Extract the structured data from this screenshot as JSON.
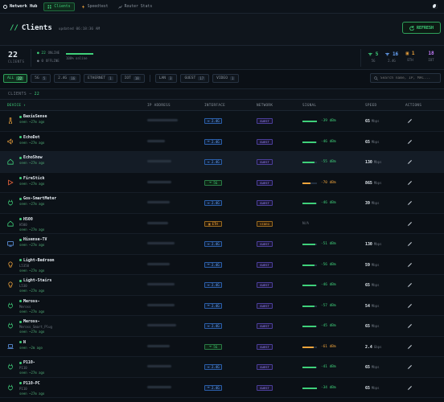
{
  "nav": {
    "brand": "Network Hub",
    "tabs": [
      {
        "label": "Clients",
        "icon": "grid-icon",
        "active": true
      },
      {
        "label": "Speedtest",
        "icon": "bolt-icon",
        "active": false
      },
      {
        "label": "Router Stats",
        "icon": "chart-icon",
        "active": false
      }
    ],
    "theme_icon": "moon-icon"
  },
  "header": {
    "prefix": "//",
    "title": "Clients",
    "updated": "updated 06:18:36 AM",
    "refresh_label": "REFRESH"
  },
  "stats": {
    "total": "22",
    "total_label": "CLIENTS",
    "online": "22",
    "online_label": "ONLINE",
    "offline": "0",
    "offline_label": "OFFLINE",
    "online_pct_text": "100% online",
    "online_fraction": 1.0,
    "bands": [
      {
        "value": "5",
        "label": "5G",
        "color": "#3fd07a"
      },
      {
        "value": "16",
        "label": "2.4G",
        "color": "#6aa8ff"
      },
      {
        "value": "1",
        "label": "ETH",
        "color": "#f0a43c"
      },
      {
        "value": "18",
        "label": "IOT",
        "color": "#c77dff"
      }
    ]
  },
  "filters": [
    {
      "label": "ALL",
      "count": "22",
      "active": true
    },
    {
      "label": "5G",
      "count": "5",
      "active": false
    },
    {
      "label": "2.4G",
      "count": "16",
      "active": false
    },
    {
      "label": "ETHERNET",
      "count": "1",
      "active": false
    },
    {
      "label": "IOT",
      "count": "18",
      "active": false
    },
    {
      "label": "LAN",
      "count": "3",
      "active": false
    },
    {
      "label": "GUEST",
      "count": "17",
      "active": false
    },
    {
      "label": "VIDEO",
      "count": "1",
      "active": false
    }
  ],
  "search": {
    "placeholder": "Search name, IP, MAC..."
  },
  "list": {
    "title": "CLIENTS",
    "sep": "—",
    "count": "22"
  },
  "columns": {
    "device": "DEVICE ↑",
    "ip": "IP ADDRESS",
    "iface": "INTERFACE",
    "network": "NETWORK",
    "signal": "SIGNAL",
    "speed": "SPEED",
    "actions": "ACTIONS"
  },
  "rows": [
    {
      "name": "BaxiuSense",
      "sub": "",
      "seen": "seen ~27m ago",
      "icon": "thermometer-icon",
      "icolor": "#f0a43c",
      "iface": "2.4G",
      "itype": "b2",
      "net": "GUEST",
      "signal": "-39 dBm",
      "sig_fill": 1.0,
      "sig_color": "#3fd07a",
      "speed": "65",
      "unit": "Mbps"
    },
    {
      "name": "EchoDot",
      "sub": "",
      "seen": "seen ~27m ago",
      "icon": "speaker-icon",
      "icolor": "#f0a43c",
      "iface": "2.4G",
      "itype": "b2",
      "net": "GUEST",
      "signal": "-46 dBm",
      "sig_fill": 0.95,
      "sig_color": "#3fd07a",
      "speed": "65",
      "unit": "Mbps"
    },
    {
      "name": "EchoShow",
      "sub": "",
      "seen": "seen ~27m ago",
      "icon": "home-icon",
      "icolor": "#3fd07a",
      "iface": "2.4G",
      "itype": "b2",
      "net": "GUEST",
      "signal": "-55 dBm",
      "sig_fill": 0.85,
      "sig_color": "#3fd07a",
      "speed": "130",
      "unit": "Mbps"
    },
    {
      "name": "FireStick",
      "sub": "",
      "seen": "seen ~27m ago",
      "icon": "play-icon",
      "icolor": "#f0663c",
      "iface": "5G",
      "itype": "b5",
      "net": "GUEST",
      "signal": "-70 dBm",
      "sig_fill": 0.55,
      "sig_color": "#f0a43c",
      "speed": "865",
      "unit": "Mbps"
    },
    {
      "name": "Gos-SmartMeter",
      "sub": "",
      "seen": "seen ~27m ago",
      "icon": "plug-icon",
      "icolor": "#3fd07a",
      "iface": "2.4G",
      "itype": "b2",
      "net": "GUEST",
      "signal": "-46 dBm",
      "sig_fill": 0.95,
      "sig_color": "#3fd07a",
      "speed": "39",
      "unit": "Mbps"
    },
    {
      "name": "H500",
      "sub": "H500",
      "seen": "seen ~27m ago",
      "icon": "home-icon",
      "icolor": "#3fd07a",
      "iface": "ETH",
      "itype": "eth",
      "net": "VIDEO",
      "signal": "N/A",
      "sig_fill": 0,
      "sig_color": "#6e7681",
      "speed": "",
      "unit": ""
    },
    {
      "name": "Hisense-TV",
      "sub": "",
      "seen": "seen ~27m ago",
      "icon": "tv-icon",
      "icolor": "#6aa8ff",
      "iface": "2.4G",
      "itype": "b2",
      "net": "GUEST",
      "signal": "-51 dBm",
      "sig_fill": 0.9,
      "sig_color": "#3fd07a",
      "speed": "130",
      "unit": "Mbps"
    },
    {
      "name": "Light-Bedroom",
      "sub": "L5350",
      "seen": "seen ~27m ago",
      "icon": "bulb-icon",
      "icolor": "#f0a43c",
      "iface": "2.4G",
      "itype": "b2",
      "net": "GUEST",
      "signal": "-56 dBm",
      "sig_fill": 0.85,
      "sig_color": "#3fd07a",
      "speed": "59",
      "unit": "Mbps"
    },
    {
      "name": "Light-Stairs",
      "sub": "L530",
      "seen": "seen ~27m ago",
      "icon": "bulb-icon",
      "icolor": "#f0a43c",
      "iface": "2.4G",
      "itype": "b2",
      "net": "GUEST",
      "signal": "-46 dBm",
      "sig_fill": 0.95,
      "sig_color": "#3fd07a",
      "speed": "65",
      "unit": "Mbps"
    },
    {
      "name": "Meross-",
      "sub": "Meross",
      "seen": "seen ~27m ago",
      "icon": "plug-icon",
      "icolor": "#3fd07a",
      "iface": "2.4G",
      "itype": "b2",
      "net": "GUEST",
      "signal": "-57 dBm",
      "sig_fill": 0.83,
      "sig_color": "#3fd07a",
      "speed": "54",
      "unit": "Mbps"
    },
    {
      "name": "Meross-",
      "sub": "Meross_Smart_Plug",
      "seen": "seen ~27m ago",
      "icon": "plug-icon",
      "icolor": "#3fd07a",
      "iface": "2.4G",
      "itype": "b2",
      "net": "GUEST",
      "signal": "-45 dBm",
      "sig_fill": 0.95,
      "sig_color": "#3fd07a",
      "speed": "65",
      "unit": "Mbps"
    },
    {
      "name": "N",
      "sub": "",
      "seen": "seen ~2m ago",
      "icon": "laptop-icon",
      "icolor": "#6aa8ff",
      "iface": "5G",
      "itype": "b5",
      "net": "GUEST",
      "signal": "-61 dBm",
      "sig_fill": 0.75,
      "sig_color": "#f0a43c",
      "speed": "2.4",
      "unit": "Gbps"
    },
    {
      "name": "P110-",
      "sub": "P110",
      "seen": "seen ~27m ago",
      "icon": "plug-icon",
      "icolor": "#3fd07a",
      "iface": "2.4G",
      "itype": "b2",
      "net": "GUEST",
      "signal": "-41 dBm",
      "sig_fill": 0.97,
      "sig_color": "#3fd07a",
      "speed": "65",
      "unit": "Mbps"
    },
    {
      "name": "P110-PC",
      "sub": "P110",
      "seen": "seen ~27m ago",
      "icon": "plug-icon",
      "icolor": "#3fd07a",
      "iface": "2.4G",
      "itype": "b2",
      "net": "GUEST",
      "signal": "-34 dBm",
      "sig_fill": 1.0,
      "sig_color": "#3fd07a",
      "speed": "65",
      "unit": "Mbps"
    }
  ]
}
